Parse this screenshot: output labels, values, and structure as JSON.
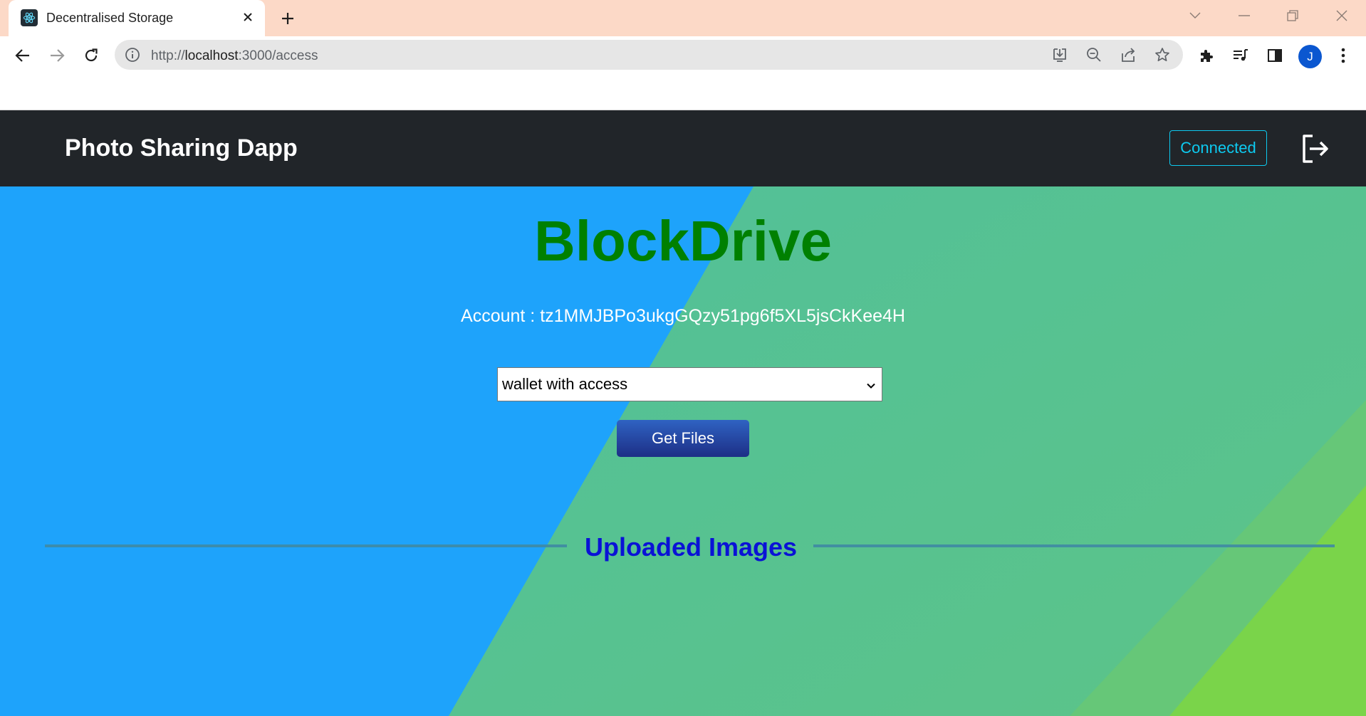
{
  "browser": {
    "tab": {
      "title": "Decentralised Storage",
      "favicon": "react-atom-icon"
    },
    "url": {
      "prefix": "http://",
      "host": "localhost",
      "rest": ":3000/access"
    },
    "profile_initial": "J"
  },
  "navbar": {
    "brand": "Photo Sharing Dapp",
    "connect_status": "Connected",
    "logout_icon": "logout-icon"
  },
  "main": {
    "title": "BlockDrive",
    "account_label": "Account : tz1MMJBPo3ukgGQzy51pg6f5XL5jsCkKee4H",
    "wallet_select": {
      "selected": "wallet with access"
    },
    "get_files_label": "Get Files",
    "section_heading": "Uploaded Images"
  },
  "colors": {
    "navbar_bg": "#212529",
    "title_green": "#008000",
    "bg_blue": "#1ea3fb",
    "bg_teal": "#52c099",
    "bg_green": "#7ad44a",
    "heading_blue": "#0a12d6",
    "connected_cyan": "#0dcaf0"
  }
}
